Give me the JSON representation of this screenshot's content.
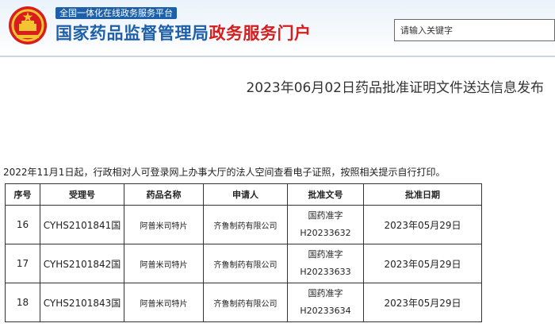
{
  "header": {
    "platform_tag": "全国一体化在线政务服务平台",
    "title_blue": "国家药品监督管理局",
    "title_red": "政务服务门户",
    "search_placeholder": "请输入关键字",
    "emblem_icon": "national-emblem-icon"
  },
  "colors": {
    "brand_blue": "#1d5fa8",
    "brand_red": "#d71d1d"
  },
  "page": {
    "title": "2023年06月02日药品批准证明文件送达信息发布",
    "notice": "2022年11月1日起，行政相对人可登录网上办事大厅的法人空间查看电子证照，按照相关提示自行打印。"
  },
  "table": {
    "headers": [
      "序号",
      "受理号",
      "药品名称",
      "申请人",
      "批准文号",
      "批准日期"
    ],
    "rows": [
      {
        "no": "16",
        "accept_no": "CYHS2101841国",
        "drug": "阿普米司特片",
        "applicant": "齐鲁制药有限公司",
        "approval_line1": "国药准字",
        "approval_line2": "H20233632",
        "date": "2023年05月29日"
      },
      {
        "no": "17",
        "accept_no": "CYHS2101842国",
        "drug": "阿普米司特片",
        "applicant": "齐鲁制药有限公司",
        "approval_line1": "国药准字",
        "approval_line2": "H20233633",
        "date": "2023年05月29日"
      },
      {
        "no": "18",
        "accept_no": "CYHS2101843国",
        "drug": "阿普米司特片",
        "applicant": "齐鲁制药有限公司",
        "approval_line1": "国药准字",
        "approval_line2": "H20233634",
        "date": "2023年05月29日"
      }
    ]
  }
}
